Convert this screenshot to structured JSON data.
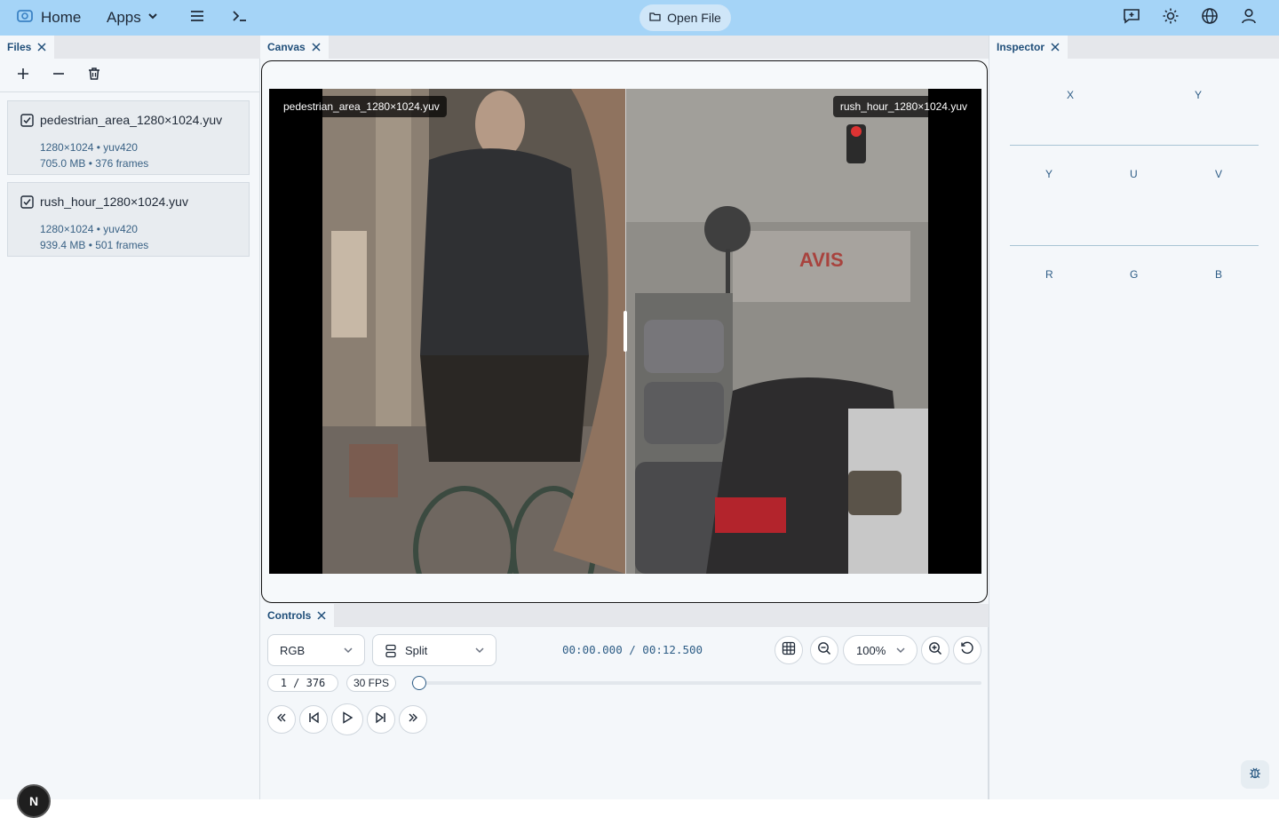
{
  "topbar": {
    "home_label": "Home",
    "apps_label": "Apps",
    "open_file_label": "Open File"
  },
  "files": {
    "tab_title": "Files",
    "items": [
      {
        "name": "pedestrian_area_1280×1024.yuv",
        "meta1": "1280×1024 • yuv420",
        "meta2": "705.0 MB • 376 frames"
      },
      {
        "name": "rush_hour_1280×1024.yuv",
        "meta1": "1280×1024 • yuv420",
        "meta2": "939.4 MB • 501 frames"
      }
    ],
    "avatar_initial": "N"
  },
  "canvas": {
    "tab_title": "Canvas",
    "left_label": "pedestrian_area_1280×1024.yuv",
    "right_label": "rush_hour_1280×1024.yuv"
  },
  "controls": {
    "tab_title": "Controls",
    "color_mode": "RGB",
    "view_mode": "Split",
    "timecode": "00:00.000 / 00:12.500",
    "zoom": "100%",
    "frame_counter": "1 / 376",
    "fps": "30 FPS",
    "progress": 0
  },
  "inspector": {
    "tab_title": "Inspector",
    "coord_labels": [
      "X",
      "Y"
    ],
    "yuv_labels": [
      "Y",
      "U",
      "V"
    ],
    "rgb_labels": [
      "R",
      "G",
      "B"
    ]
  },
  "colors": {
    "topbar_bg": "#a5d4f7",
    "accent": "#2e5d86"
  }
}
